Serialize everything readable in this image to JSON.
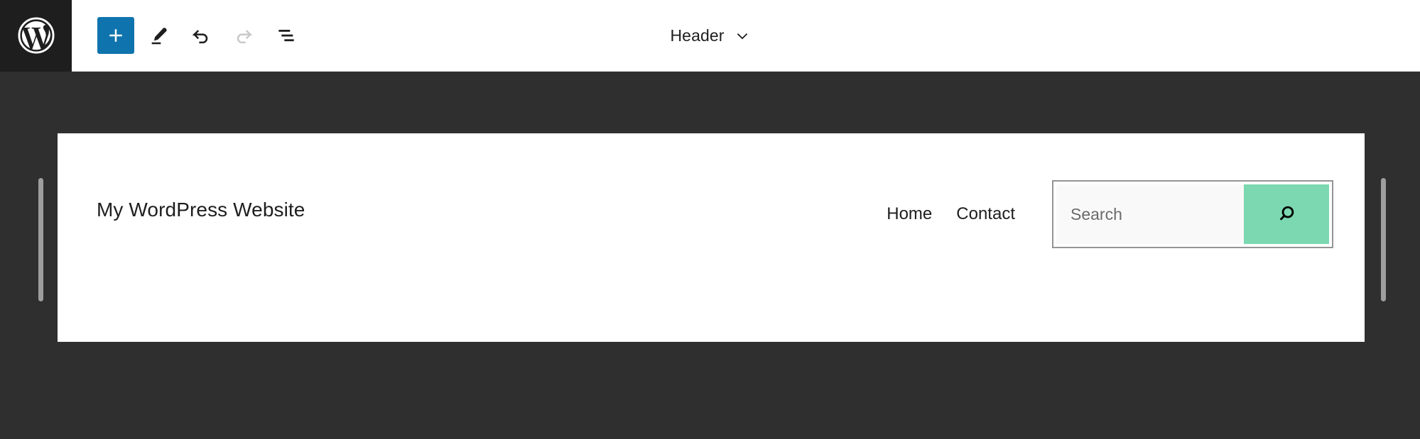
{
  "app": {
    "logo_icon": "wordpress-logo-icon",
    "accent_blue": "#0f74ad",
    "canvas_background": "#2f2f2f"
  },
  "toolbar": {
    "buttons": [
      {
        "name": "add-block",
        "icon": "plus-icon",
        "label": "Add block",
        "state": "primary"
      },
      {
        "name": "edit-mode",
        "icon": "pencil-icon",
        "label": "Edit",
        "state": "default"
      },
      {
        "name": "undo",
        "icon": "undo-arrow-icon",
        "label": "Undo",
        "state": "default"
      },
      {
        "name": "redo",
        "icon": "redo-arrow-icon",
        "label": "Redo",
        "state": "disabled"
      },
      {
        "name": "list-view",
        "icon": "list-view-icon",
        "label": "List View",
        "state": "default"
      }
    ],
    "document_bar": {
      "title": "Header",
      "chevron_icon": "chevron-down-icon"
    }
  },
  "canvas": {
    "resize_handle_left": "resize-handle-left",
    "resize_handle_right": "resize-handle-right"
  },
  "header_block": {
    "site_title": "My WordPress Website",
    "navigation": [
      {
        "label": "Home"
      },
      {
        "label": "Contact"
      }
    ],
    "search_block": {
      "placeholder": "Search",
      "value": "",
      "button_icon": "search-magnifier-icon",
      "button_color": "#7bd8b0",
      "selected": true
    }
  }
}
